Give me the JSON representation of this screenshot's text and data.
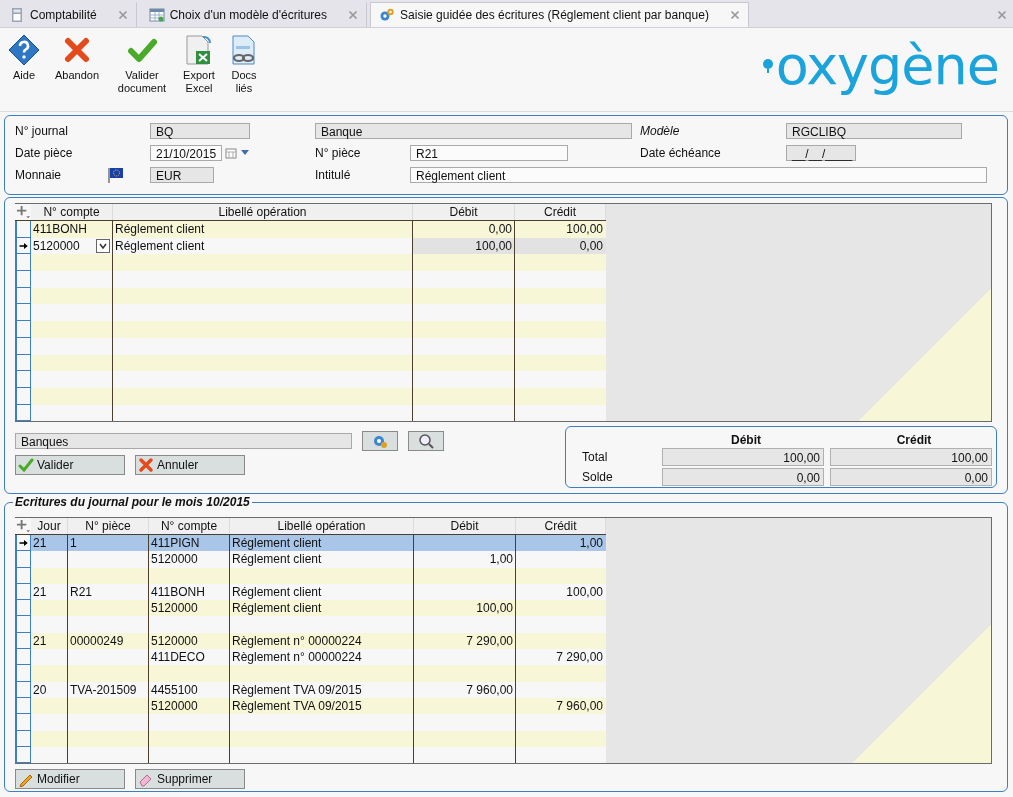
{
  "tabs": [
    {
      "label": "Comptabilité",
      "kind": "calculator",
      "selected": false
    },
    {
      "label": "Choix d'un modèle d'écritures",
      "kind": "table",
      "selected": false
    },
    {
      "label": "Saisie guidée des écritures (Réglement client par banque)",
      "kind": "gears",
      "selected": true
    }
  ],
  "toolbar": [
    {
      "label": "Aide",
      "kind": "help"
    },
    {
      "label": "Abandon",
      "kind": "cancel"
    },
    {
      "label": "Valider document",
      "kind": "validate"
    },
    {
      "label": "Export Excel",
      "kind": "excel"
    },
    {
      "label": "Docs liés",
      "kind": "docs"
    }
  ],
  "logo": {
    "text": "oxygène"
  },
  "header": {
    "journal": {
      "label": "N° journal",
      "value": "BQ",
      "readonly": true
    },
    "journal_name": {
      "value": "Banque",
      "readonly": true
    },
    "model": {
      "label": "Modèle",
      "value": "RGCLIBQ",
      "readonly": true
    },
    "date": {
      "label": "Date pièce",
      "value": "21/10/2015",
      "readonly": false
    },
    "piece": {
      "label": "N° pièce",
      "value": "R21",
      "readonly": false
    },
    "due_date": {
      "label": "Date échéance",
      "value": "__/__/____",
      "readonly": true
    },
    "currency": {
      "label": "Monnaie",
      "value": "EUR",
      "readonly": true
    },
    "title": {
      "label": "Intitulé",
      "value": "Réglement client",
      "readonly": false
    }
  },
  "entry_table": {
    "columns": [
      "N° compte",
      "Libellé opération",
      "Débit",
      "Crédit"
    ],
    "rows": [
      {
        "compte": "411BONH",
        "libelle": "Réglement client",
        "debit": "0,00",
        "credit": "100,00",
        "selected": false
      },
      {
        "compte": "5120000",
        "libelle": "Réglement client",
        "debit": "100,00",
        "credit": "0,00",
        "selected": true
      }
    ]
  },
  "account_field": {
    "value": "Banques"
  },
  "entry_buttons": [
    {
      "label": "Valider",
      "kind": "ok"
    },
    {
      "label": "Annuler",
      "kind": "cancel"
    }
  ],
  "totals": {
    "columns": [
      "Débit",
      "Crédit"
    ],
    "rows": [
      {
        "label": "Total",
        "debit": "100,00",
        "credit": "100,00"
      },
      {
        "label": "Solde",
        "debit": "0,00",
        "credit": "0,00"
      }
    ]
  },
  "journal": {
    "title": "Ecritures du journal pour le mois 10/2015",
    "columns": [
      "Jour",
      "N° pièce",
      "N° compte",
      "Libellé opération",
      "Débit",
      "Crédit"
    ],
    "groups": [
      {
        "jour": "21",
        "piece": "1",
        "lines": [
          {
            "compte": "411PIGN",
            "libelle": "Réglement client",
            "credit": "1,00",
            "selected": true
          },
          {
            "compte": "5120000",
            "libelle": "Réglement client",
            "debit": "1,00",
            "selected": false
          }
        ]
      },
      {
        "jour": "21",
        "piece": "R21",
        "lines": [
          {
            "compte": "411BONH",
            "libelle": "Réglement client",
            "credit": "100,00",
            "selected": false
          },
          {
            "compte": "5120000",
            "libelle": "Réglement client",
            "debit": "100,00",
            "selected": false
          }
        ]
      },
      {
        "jour": "21",
        "piece": "00000249",
        "lines": [
          {
            "compte": "5120000",
            "libelle": "Règlement n° 00000224",
            "debit": "7 290,00",
            "selected": false
          },
          {
            "compte": "411DECO",
            "libelle": "Règlement n° 00000224",
            "credit": "7 290,00",
            "selected": false
          }
        ]
      },
      {
        "jour": "20",
        "piece": "TVA-201509",
        "lines": [
          {
            "compte": "4455100",
            "libelle": "Règlement TVA 09/2015",
            "debit": "7 960,00",
            "selected": false
          },
          {
            "compte": "5120000",
            "libelle": "Règlement TVA 09/2015",
            "credit": "7 960,00",
            "selected": false
          }
        ]
      }
    ]
  },
  "journal_buttons": [
    {
      "label": "Modifier",
      "kind": "edit"
    },
    {
      "label": "Supprimer",
      "kind": "delete"
    }
  ]
}
